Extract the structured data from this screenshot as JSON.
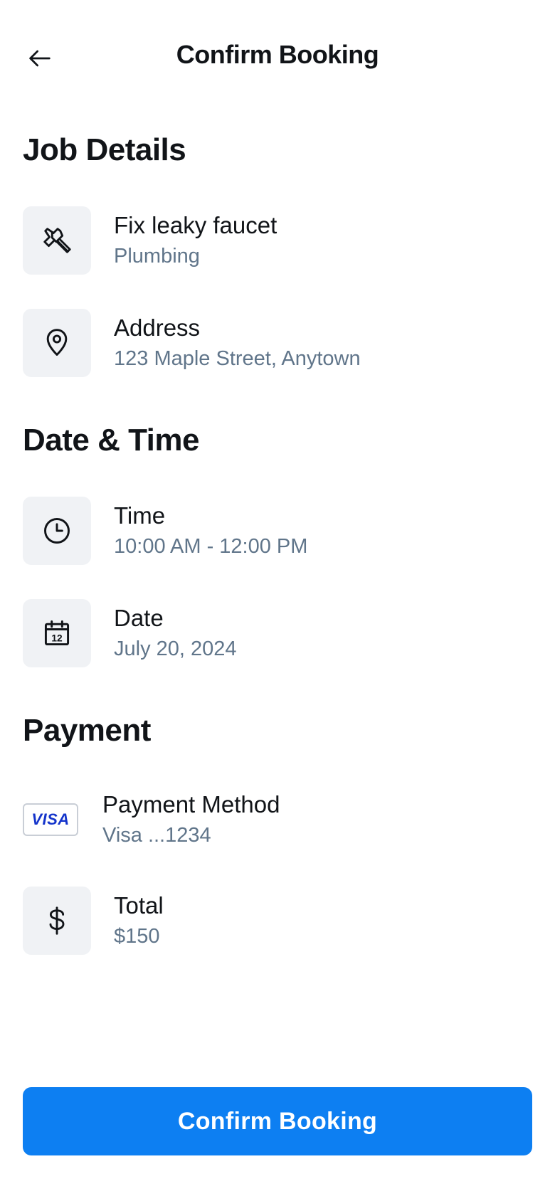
{
  "header": {
    "title": "Confirm Booking",
    "back_icon": "arrow-left-icon"
  },
  "sections": {
    "job": {
      "title": "Job Details",
      "items": [
        {
          "icon": "hammer-icon",
          "label": "Fix leaky faucet",
          "value": "Plumbing"
        },
        {
          "icon": "map-pin-icon",
          "label": "Address",
          "value": "123 Maple Street, Anytown"
        }
      ]
    },
    "datetime": {
      "title": "Date & Time",
      "items": [
        {
          "icon": "clock-icon",
          "label": "Time",
          "value": "10:00 AM - 12:00 PM"
        },
        {
          "icon": "calendar-icon",
          "label": "Date",
          "value": "July 20, 2024",
          "calendar_day": "12"
        }
      ]
    },
    "payment": {
      "title": "Payment",
      "items": [
        {
          "icon": "visa-card-icon",
          "card_brand": "VISA",
          "label": "Payment Method",
          "value": "Visa ...1234"
        },
        {
          "icon": "dollar-icon",
          "label": "Total",
          "value": "$150"
        }
      ]
    }
  },
  "footer": {
    "confirm_label": "Confirm Booking"
  },
  "colors": {
    "primary": "#0d7ff2",
    "icon_bg": "#f0f2f5",
    "secondary_text": "#60758a",
    "visa_blue": "#1434cb"
  }
}
